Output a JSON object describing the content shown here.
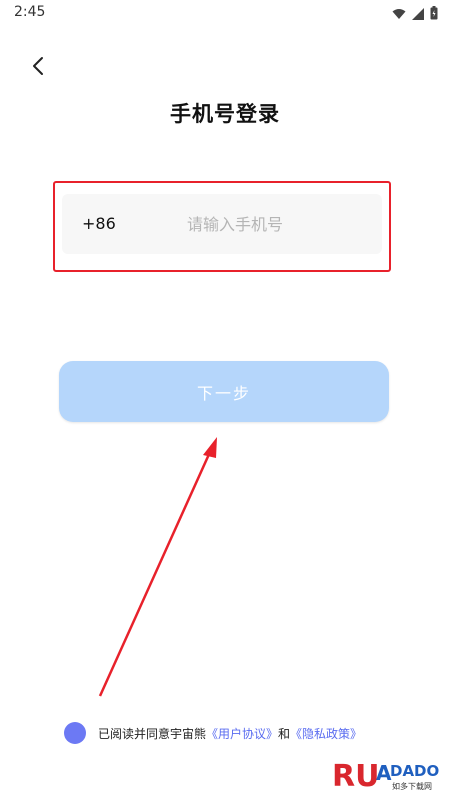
{
  "status_bar": {
    "time": "2:45",
    "icons": [
      "wifi-icon",
      "cellular-signal-icon",
      "battery-icon"
    ]
  },
  "header": {
    "back_icon": "chevron-left-icon",
    "title": "手机号登录"
  },
  "phone_form": {
    "country_code": "+86",
    "phone_value": "",
    "phone_placeholder": "请输入手机号"
  },
  "actions": {
    "next_label": "下一步"
  },
  "agreement": {
    "prefix": "已阅读并同意宇宙熊",
    "user_agreement": "《用户协议》",
    "conjunction": "和",
    "privacy_policy": "《隐私政策》",
    "checked": true
  },
  "watermark": {
    "brand": "RUANDADO",
    "tagline": "如多下载网"
  },
  "colors": {
    "highlight_border": "#e8212b",
    "next_button_bg": "#b5d6fb",
    "radio_fill": "#6c79f4",
    "link": "#5a6cf0",
    "input_bg": "#f7f7f7"
  }
}
